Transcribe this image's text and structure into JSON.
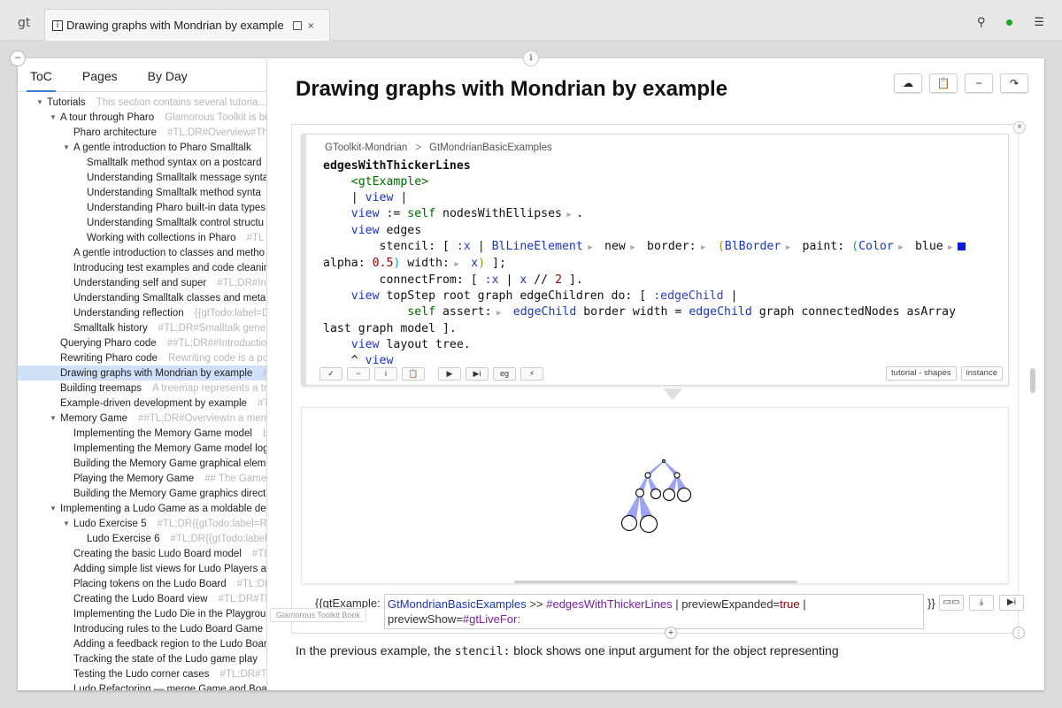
{
  "app": {
    "logo": "gt"
  },
  "tab": {
    "info": "i",
    "title": "Drawing graphs with Mondrian by example",
    "close": "×"
  },
  "top_actions": {
    "search": "⚲",
    "menu": "☰"
  },
  "controls": {
    "collapse": "−",
    "info": "i"
  },
  "sidebar": {
    "tabs": [
      "ToC",
      "Pages",
      "By Day"
    ],
    "items": [
      {
        "indent": 1,
        "expanded": true,
        "label": "Tutorials",
        "desc": "This section contains several tutoria..."
      },
      {
        "indent": 2,
        "expanded": true,
        "label": "A tour through Pharo",
        "desc": "Glamorous Toolkit is bu"
      },
      {
        "indent": 3,
        "expanded": null,
        "label": "Pharo architecture",
        "desc": "#TL;DR#Overview#The"
      },
      {
        "indent": 3,
        "expanded": true,
        "label": "A gentle introduction to Pharo Smalltalk",
        "desc": ""
      },
      {
        "indent": 4,
        "expanded": null,
        "label": "Smalltalk method syntax on a postcard",
        "desc": ""
      },
      {
        "indent": 4,
        "expanded": null,
        "label": "Understanding Smalltalk message synta",
        "desc": ""
      },
      {
        "indent": 4,
        "expanded": null,
        "label": "Understanding Smalltalk method synta",
        "desc": ""
      },
      {
        "indent": 4,
        "expanded": null,
        "label": "Understanding Pharo built-in data types",
        "desc": ""
      },
      {
        "indent": 4,
        "expanded": null,
        "label": "Understanding Smalltalk control structu",
        "desc": ""
      },
      {
        "indent": 4,
        "expanded": null,
        "label": "Working with collections in Pharo",
        "desc": "#TL"
      },
      {
        "indent": 3,
        "expanded": null,
        "label": "A gentle introduction to classes and metho",
        "desc": ""
      },
      {
        "indent": 3,
        "expanded": null,
        "label": "Introducing test examples and code cleaning",
        "desc": ""
      },
      {
        "indent": 3,
        "expanded": null,
        "label": "Understanding self and super",
        "desc": "#TL;DR#Intr"
      },
      {
        "indent": 3,
        "expanded": null,
        "label": "Understanding Smalltalk classes and metacl",
        "desc": ""
      },
      {
        "indent": 3,
        "expanded": null,
        "label": "Understanding reflection",
        "desc": "{{gtTodo:label=D"
      },
      {
        "indent": 3,
        "expanded": null,
        "label": "Smalltalk history",
        "desc": "#TL;DR#Smalltalk genea"
      },
      {
        "indent": 2,
        "expanded": null,
        "label": "Querying Pharo code",
        "desc": "##TL;DR##Introduction"
      },
      {
        "indent": 2,
        "expanded": null,
        "label": "Rewriting Pharo code",
        "desc": "Rewriting code is a pow"
      },
      {
        "indent": 2,
        "expanded": null,
        "label": "Drawing graphs with Mondrian by example",
        "desc": "#",
        "selected": true
      },
      {
        "indent": 2,
        "expanded": null,
        "label": "Building treemaps",
        "desc": "A treemap represents a tre"
      },
      {
        "indent": 2,
        "expanded": null,
        "label": "Example-driven development by example",
        "desc": "#T"
      },
      {
        "indent": 2,
        "expanded": true,
        "label": "Memory Game",
        "desc": "##TL;DR#OverviewIn a memo"
      },
      {
        "indent": 3,
        "expanded": null,
        "label": "Implementing the Memory Game model",
        "desc": "Le"
      },
      {
        "indent": 3,
        "expanded": null,
        "label": "Implementing the Memory Game model logi",
        "desc": ""
      },
      {
        "indent": 3,
        "expanded": null,
        "label": "Building the Memory Game graphical eleme",
        "desc": ""
      },
      {
        "indent": 3,
        "expanded": null,
        "label": "Playing the Memory Game",
        "desc": "## The Game E"
      },
      {
        "indent": 3,
        "expanded": null,
        "label": "Building the Memory Game graphics directly",
        "desc": ""
      },
      {
        "indent": 2,
        "expanded": true,
        "label": "Implementing a Ludo Game as a moldable deve",
        "desc": ""
      },
      {
        "indent": 3,
        "expanded": true,
        "label": "Ludo Exercise 5",
        "desc": "#TL;DR{{gtTodo:label=REV"
      },
      {
        "indent": 4,
        "expanded": null,
        "label": "Ludo Exercise 6",
        "desc": "#TL;DR{{gtTodo:label="
      },
      {
        "indent": 3,
        "expanded": null,
        "label": "Creating the basic Ludo Board model",
        "desc": "#TL"
      },
      {
        "indent": 3,
        "expanded": null,
        "label": "Adding simple list views for Ludo Players an",
        "desc": ""
      },
      {
        "indent": 3,
        "expanded": null,
        "label": "Placing tokens on the Ludo Board",
        "desc": "#TL;DR#"
      },
      {
        "indent": 3,
        "expanded": null,
        "label": "Creating the Ludo Board view",
        "desc": "#TL;DR#The"
      },
      {
        "indent": 3,
        "expanded": null,
        "label": "Implementing the Ludo Die in the Playgroun",
        "desc": ""
      },
      {
        "indent": 3,
        "expanded": null,
        "label": "Introducing rules to the Ludo Board Game",
        "desc": ""
      },
      {
        "indent": 3,
        "expanded": null,
        "label": "Adding a feedback region to the Ludo Board",
        "desc": ""
      },
      {
        "indent": 3,
        "expanded": null,
        "label": "Tracking the state of the Ludo game play",
        "desc": ""
      },
      {
        "indent": 3,
        "expanded": null,
        "label": "Testing the Ludo corner cases",
        "desc": "#TL;DR#Tes"
      },
      {
        "indent": 3,
        "expanded": null,
        "label": "Ludo Refactoring — merge Game and Board",
        "desc": ""
      }
    ]
  },
  "page": {
    "title": "Drawing graphs with Mondrian by example",
    "actions": [
      {
        "name": "cloud-upload-icon",
        "glyph": "☁"
      },
      {
        "name": "clipboard-icon",
        "glyph": "📋"
      },
      {
        "name": "minimize-icon",
        "glyph": "−"
      },
      {
        "name": "share-icon",
        "glyph": "↷"
      }
    ],
    "close": "×"
  },
  "example": {
    "crumb": {
      "package": "GToolkit-Mondrian",
      "separator": ">",
      "class": "GtMondrianBasicExamples"
    },
    "method_name": "edgesWithThickerLines",
    "tools": [
      "✓",
      "−",
      "i",
      "📋",
      "▶",
      "▶i",
      "eg",
      "⚡"
    ],
    "tags": [
      "tutorial - shapes",
      "instance"
    ]
  },
  "snippet": {
    "open": "{{gtExample:",
    "class": "GtMondrianBasicExamples",
    "arrows": ">>",
    "selector": "#edgesWithThickerLines",
    "param1_name": "| previewExpanded=",
    "param1_value": "true",
    "param2": "|",
    "line2_name": "previewShow=",
    "line2_value": "#gtLiveFor:",
    "close": "}}",
    "buttons": [
      "▭▭",
      "⤓",
      "▶i"
    ]
  },
  "add": "+",
  "grip": "⋮",
  "paragraph": {
    "before": "In the previous example, the ",
    "code": "stencil:",
    "after": " block shows one input argument for the object representing"
  },
  "book_tag": "Glamorous Toolkit Book",
  "colors": {
    "accent": "#3b7bd6",
    "selection": "#cfe0f7",
    "edge": "#4c5ae6",
    "class_ref": "#1a35c4",
    "selector": "#7a1fa2"
  }
}
